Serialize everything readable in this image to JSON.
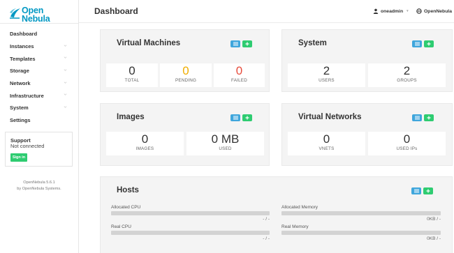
{
  "brand": {
    "line1": "Open",
    "line2": "Nebula"
  },
  "sidebar": {
    "items": [
      {
        "label": "Dashboard",
        "chevron": false
      },
      {
        "label": "Instances",
        "chevron": true
      },
      {
        "label": "Templates",
        "chevron": true
      },
      {
        "label": "Storage",
        "chevron": true
      },
      {
        "label": "Network",
        "chevron": true
      },
      {
        "label": "Infrastructure",
        "chevron": true
      },
      {
        "label": "System",
        "chevron": true
      },
      {
        "label": "Settings",
        "chevron": false
      }
    ],
    "support": {
      "title": "Support",
      "status": "Not connected",
      "signin": "Sign in"
    },
    "version": "OpenNebula 5.6.1",
    "by_prefix": "by ",
    "by_name": "OpenNebula Systems."
  },
  "header": {
    "title": "Dashboard",
    "user": "oneadmin",
    "zone": "OpenNebula"
  },
  "cards": {
    "vms": {
      "title": "Virtual Machines",
      "stats": [
        {
          "value": "0",
          "label": "TOTAL"
        },
        {
          "value": "0",
          "label": "PENDING"
        },
        {
          "value": "0",
          "label": "FAILED"
        }
      ]
    },
    "system": {
      "title": "System",
      "stats": [
        {
          "value": "2",
          "label": "USERS"
        },
        {
          "value": "2",
          "label": "GROUPS"
        }
      ]
    },
    "images": {
      "title": "Images",
      "stats": [
        {
          "value": "0",
          "label": "IMAGES"
        },
        {
          "value": "0 MB",
          "label": "USED"
        }
      ]
    },
    "vnets": {
      "title": "Virtual Networks",
      "stats": [
        {
          "value": "0",
          "label": "VNETS"
        },
        {
          "value": "0",
          "label": "USED IPs"
        }
      ]
    },
    "hosts": {
      "title": "Hosts",
      "bars": [
        {
          "label": "Allocated CPU",
          "value": "- / -"
        },
        {
          "label": "Allocated Memory",
          "value": "0KB / -"
        },
        {
          "label": "Real CPU",
          "value": "- / -"
        },
        {
          "label": "Real Memory",
          "value": "0KB / -"
        }
      ]
    }
  },
  "colors": {
    "accent": "#0098c3",
    "pending": "#f0ad00",
    "failed": "#e74c3c",
    "green": "#2ecc71",
    "blue": "#3fa6dc"
  }
}
